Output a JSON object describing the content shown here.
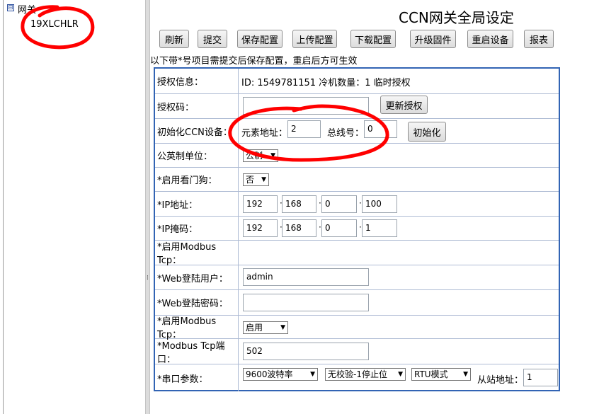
{
  "tree": {
    "toggle_symbol": "⊟",
    "root_label": "网关",
    "child_label": "19XLCHLR"
  },
  "header": {
    "title": "CCN网关全局设定"
  },
  "toolbar": {
    "refresh": "刷新",
    "submit": "提交",
    "save_config": "保存配置",
    "upload_config": "上传配置",
    "download_config": "下载配置",
    "upgrade_firmware": "升级固件",
    "restart_device": "重启设备",
    "report": "报表"
  },
  "note": "以下带*号项目需提交后保存配置，重启后方可生效",
  "rows": {
    "license_info": {
      "label": "授权信息：",
      "value": "ID: 1549781151 冷机数量：1 临时授权"
    },
    "license_code": {
      "label": "授权码：",
      "value": "",
      "button": "更新授权"
    },
    "init_ccn": {
      "label": "初始化CCN设备：",
      "element_addr_label": "元素地址：",
      "element_addr": "2",
      "bus_label": "总线号：",
      "bus": "0",
      "button": "初始化"
    },
    "unit": {
      "label": "公英制单位：",
      "value": "公制"
    },
    "watchdog": {
      "label": "*启用看门狗：",
      "value": "否"
    },
    "ip": {
      "label": "*IP地址：",
      "octets": [
        "192",
        "168",
        "0",
        "100"
      ]
    },
    "mask": {
      "label": "*IP掩码：",
      "octets": [
        "192",
        "168",
        "0",
        "1"
      ]
    },
    "modbus_enable_1": {
      "label": "*启用Modbus Tcp："
    },
    "web_user": {
      "label": "*Web登陆用户：",
      "value": "admin"
    },
    "web_password": {
      "label": "*Web登陆密码：",
      "value": ""
    },
    "modbus_enable_2": {
      "label": "*启用Modbus Tcp：",
      "value": "启用"
    },
    "modbus_port": {
      "label": "*Modbus Tcp端口：",
      "value": "502"
    },
    "serial": {
      "label": "*串口参数：",
      "baud": "9600波特率",
      "parity": "无校验-1停止位",
      "mode": "RTU模式",
      "slave_label": "从站地址：",
      "slave": "1"
    }
  },
  "colors": {
    "table_border": "#3264b4",
    "annotation": "#ff0000"
  },
  "icons": {
    "dropdown": "chevron-down-icon",
    "tree_toggle": "tree-collapse-icon"
  }
}
